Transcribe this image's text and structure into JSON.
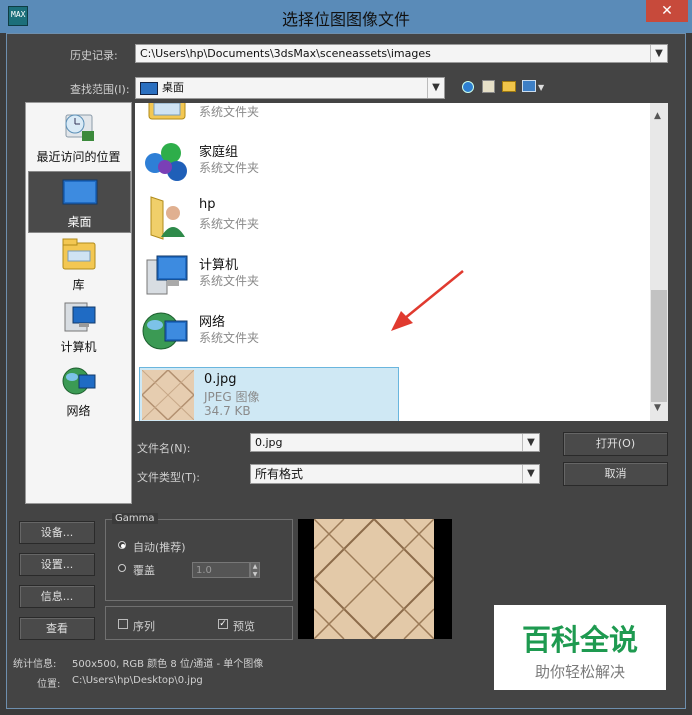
{
  "window": {
    "title": "选择位图图像文件",
    "close_glyph": "✕",
    "app_icon_text": "MAX"
  },
  "history": {
    "label": "历史记录:",
    "value": "C:\\Users\\hp\\Documents\\3dsMax\\sceneassets\\images"
  },
  "lookin": {
    "label": "查找范围(I):",
    "value": "桌面"
  },
  "places": [
    {
      "label": "最近访问的位置",
      "icon": "recent-places-icon"
    },
    {
      "label": "桌面",
      "icon": "desktop-icon",
      "selected": true
    },
    {
      "label": "库",
      "icon": "libraries-icon"
    },
    {
      "label": "计算机",
      "icon": "computer-icon"
    },
    {
      "label": "网络",
      "icon": "network-icon"
    }
  ],
  "files": [
    {
      "name": "",
      "sub": "系统文件夹",
      "icon": "libraries-folder-icon"
    },
    {
      "name": "家庭组",
      "sub": "系统文件夹",
      "icon": "homegroup-icon"
    },
    {
      "name": "hp",
      "sub": "系统文件夹",
      "icon": "user-folder-icon"
    },
    {
      "name": "计算机",
      "sub": "系统文件夹",
      "icon": "computer-icon"
    },
    {
      "name": "网络",
      "sub": "系统文件夹",
      "icon": "network-icon"
    },
    {
      "name": "0.jpg",
      "sub": "JPEG 图像",
      "size": "34.7 KB",
      "icon": "jpg-thumbnail",
      "selected": true
    }
  ],
  "filename": {
    "label": "文件名(N):",
    "value": "0.jpg"
  },
  "filetype": {
    "label": "文件类型(T):",
    "value": "所有格式"
  },
  "buttons": {
    "open": "打开(O)",
    "cancel": "取消",
    "setup": "设备...",
    "settings": "设置...",
    "info": "信息...",
    "view": "查看"
  },
  "gamma": {
    "title": "Gamma",
    "auto": "自动(推荐)",
    "override": "覆盖",
    "override_value": "1.0"
  },
  "options": {
    "sequence": "序列",
    "preview": "预览",
    "preview_checked": true,
    "sequence_checked": false
  },
  "stats": {
    "label": "统计信息:",
    "value": "500x500, RGB 颜色 8 位/通道 - 单个图像"
  },
  "location": {
    "label": "位置:",
    "value": "C:\\Users\\hp\\Desktop\\0.jpg"
  },
  "watermark": {
    "title": "百科全说",
    "subtitle": "助你轻松解决"
  },
  "colors": {
    "titlebar": "#5a8bb8",
    "selection": "#cfe8f4",
    "arrow": "#e03a2f",
    "watermark": "#1e9a50"
  }
}
